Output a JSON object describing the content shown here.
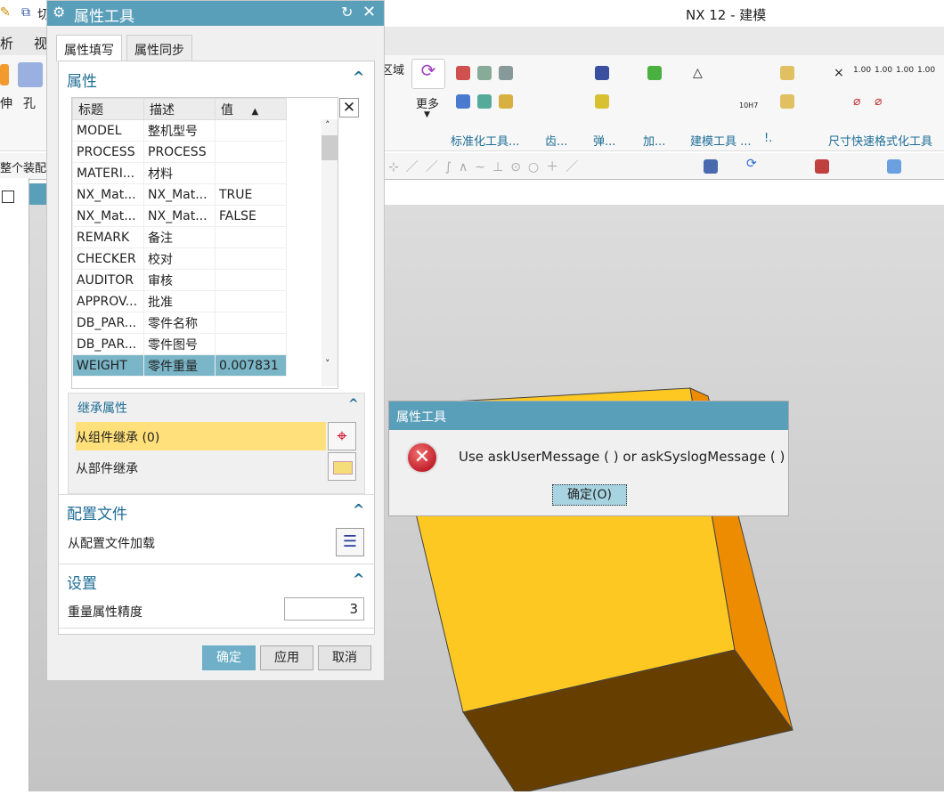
{
  "app": {
    "title": "NX 12 - 建模",
    "menu_partial": [
      "析",
      "视"
    ],
    "quick_partial": "切",
    "ribbon_left": [
      "伸",
      "孔"
    ],
    "region_partial": "区域",
    "more_label": "更多",
    "ribbon_groups": [
      "标准化工具...",
      "齿...",
      "弹...",
      "加...",
      "建模工具 ...",
      "!.",
      "尺寸快速格式化工具"
    ],
    "assembly_filter": "整个装配",
    "dim_labels": [
      "1.00",
      "1.00",
      "1.00",
      "1.00"
    ],
    "tol_label": "10H7"
  },
  "dialog": {
    "title": "属性工具",
    "tabs": [
      "属性填写",
      "属性同步"
    ],
    "active_tab": 0,
    "attributes": {
      "header": "属性",
      "columns": [
        "标题",
        "描述",
        "值"
      ],
      "sort_column": "值",
      "sort": "ascending",
      "rows": [
        [
          "MODEL",
          "整机型号",
          ""
        ],
        [
          "PROCESS",
          "PROCESS",
          ""
        ],
        [
          "MATERI...",
          "材料",
          ""
        ],
        [
          "NX_Mat...",
          "NX_Mat...",
          "TRUE"
        ],
        [
          "NX_Mat...",
          "NX_Mat...",
          "FALSE"
        ],
        [
          "REMARK",
          "备注",
          ""
        ],
        [
          "CHECKER",
          "校对",
          ""
        ],
        [
          "AUDITOR",
          "审核",
          ""
        ],
        [
          "APPROV...",
          "批准",
          ""
        ],
        [
          "DB_PAR...",
          "零件名称",
          ""
        ],
        [
          "DB_PAR...",
          "零件图号",
          ""
        ],
        [
          "WEIGHT",
          "零件重量",
          "0.007831"
        ]
      ],
      "selected_row": 11
    },
    "inherit": {
      "header": "继承属性",
      "from_component": "从组件继承 (0)",
      "from_part": "从部件继承"
    },
    "config": {
      "header": "配置文件",
      "load": "从配置文件加载"
    },
    "settings": {
      "header": "设置",
      "precision_label": "重量属性精度",
      "precision_value": "3"
    },
    "buttons": {
      "ok": "确定",
      "apply": "应用",
      "cancel": "取消"
    }
  },
  "message": {
    "title": "属性工具",
    "text": "Use askUserMessage ( ) or askSyslogMessage ( )",
    "ok": "确定(O)",
    "icon": "error-icon"
  },
  "colors": {
    "accent": "#5a9fba",
    "highlight": "#ffe07a",
    "selection": "#7ab6c8",
    "part_face": "#fdc821",
    "part_side": "#ee8c00",
    "part_bottom": "#663f00"
  }
}
